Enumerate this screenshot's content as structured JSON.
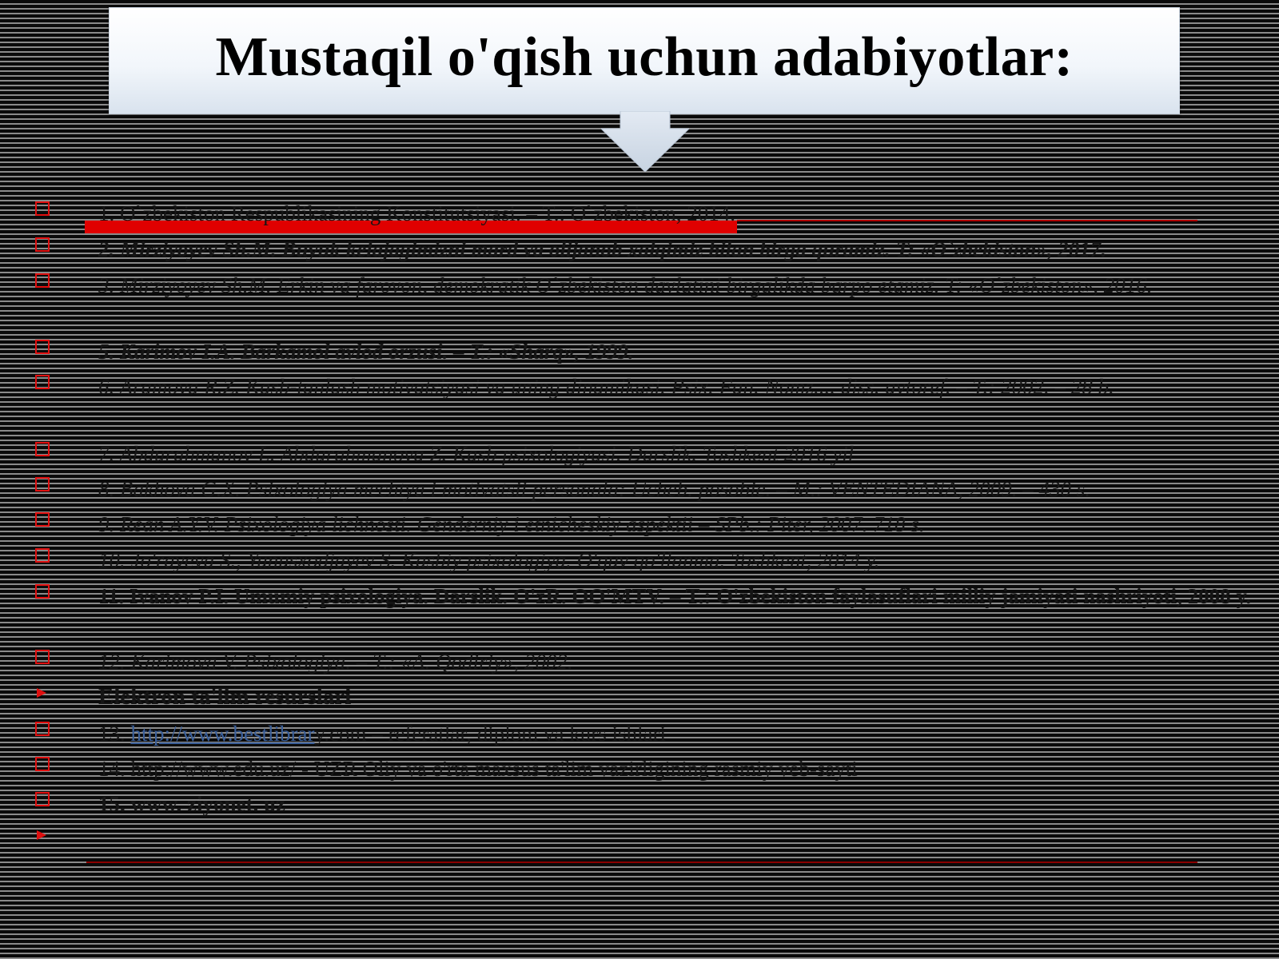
{
  "slide": {
    "title": "Mustaqil o'qish uchun adabiyotlar:"
  },
  "colors": {
    "accent_red": "#e00000",
    "title_box": "#f2f6fb",
    "background": "#0a0a0a"
  },
  "references": [
    "1. O`zbekiston Respublikasining Konstitutsiyasi. – T.: O`zbekiston, 2014.",
    "2. Mirziyoyev Sh.M. Buyuk kelajagimizni mard va olijanob xalqimiz bilan birga quramiz. T: «O`zbekiston», 2017.",
    "3. Mirziyoyev Sh.M. Erkin va farovon, demokratik O`zbekiston davlatini birgalikda barpo etamiz. T: «O`zbekiston», 2016.",
    "5. Karimov I.A. Barkamol avlod orzusi. – T.: «Sharq», 1999.",
    "6. Aramova R.Z. Kasb-tanlash motivatsiyasi va uning dinamikasi. Psix. Fan. Nomz.... diss. avtoref. – T.: 2002. – 28 b.",
    "7. Abdurahmanov L. Abdurahmanova Z. Kasb psixologiyasi. Darslik. Toshkent 2016 yil",
    "8. Bakhova G.X. Psixologiya mechtya i motivatsii personala: Ucheb. posobie. – M.: VENTEDIANA, 2009. – 430 s.",
    "9. Rean A.Y.V. Psixologiya lichnosti. Genderniy i etnicheskiy aspektii – SPb.: Piter, 2007. 718 s.",
    "10. Jo'rayeva S., Yunusxodjayev S. Kasbiy psixologiya. O'quv qo'llanma. Toshkent, 2014 y.",
    "11. Ivanov P.I. Umumiy psixologiya. Darslik. O'zR. OO'MTV. – T.: O'zbekiston faylasuflari milliy jamiyati nashriyoti, 2008 y.",
    "12. Karimova V. Psixologiya. – T.: «A. Qodiriy», 2002.",
    "Elektron ta'lim resurslari",
    "13. http://www.bestlibrary.com – referatlar, diplom va kurs ishlari",
    "14. http://www.edu.uz/ - UZR Oliy va o'rta maxsus ta'lim vazirligining rasmiy veb-sayti",
    "15. www. ziyonet. uz"
  ],
  "link_13": {
    "prefix": "13. ",
    "url": "http://www.bestlibrar",
    "suffix": "y.com – referatlar, diplom va kurs ishlari"
  }
}
